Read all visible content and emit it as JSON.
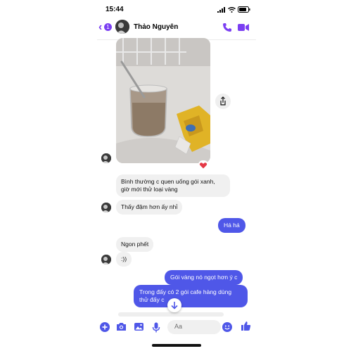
{
  "status": {
    "time": "15:44"
  },
  "header": {
    "back_badge": "1",
    "contact_name": "Thảo Nguyên"
  },
  "messages": {
    "in_1": "Bình thường c quen uống gói xanh, giờ mới thử loại vàng",
    "in_2": "Thấy đậm hơn ấy nhỉ",
    "out_1": "Há há",
    "in_3": "Ngon phết",
    "in_4": ":))",
    "out_2": "Gói vàng nó ngọt hơn ý c",
    "out_3": "Trong đấy có 2 gói cafe hàng dùng thử đấy c"
  },
  "composer": {
    "placeholder": "Aa"
  },
  "colors": {
    "accent": "#7b3ff2",
    "outgoing_bubble": "#4f57e8",
    "incoming_bubble": "#f0f0f0"
  },
  "icons": [
    "back-arrow-icon",
    "phone-icon",
    "video-camera-icon",
    "share-icon",
    "heart-icon",
    "plus-icon",
    "camera-icon",
    "photo-icon",
    "microphone-icon",
    "emoji-icon",
    "thumbs-up-icon",
    "arrow-down-icon"
  ]
}
